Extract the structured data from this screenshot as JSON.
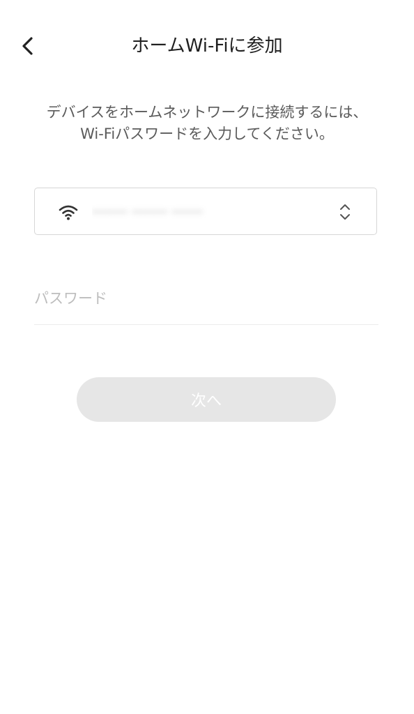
{
  "header": {
    "title": "ホームWi-Fiに参加"
  },
  "instruction": "デバイスをホームネットワークに接続するには、\nWi-Fiパスワードを入力してください。",
  "network": {
    "ssid": "········ ········ ·······"
  },
  "password": {
    "placeholder": "パスワード",
    "value": ""
  },
  "next_button": {
    "label": "次へ"
  },
  "colors": {
    "button_disabled_bg": "#e6e6e6",
    "border": "#d6d6d6",
    "placeholder": "#bdbdbd"
  },
  "icons": {
    "back": "chevron-left-icon",
    "wifi": "wifi-icon",
    "selector": "up-down-chevron-icon"
  }
}
